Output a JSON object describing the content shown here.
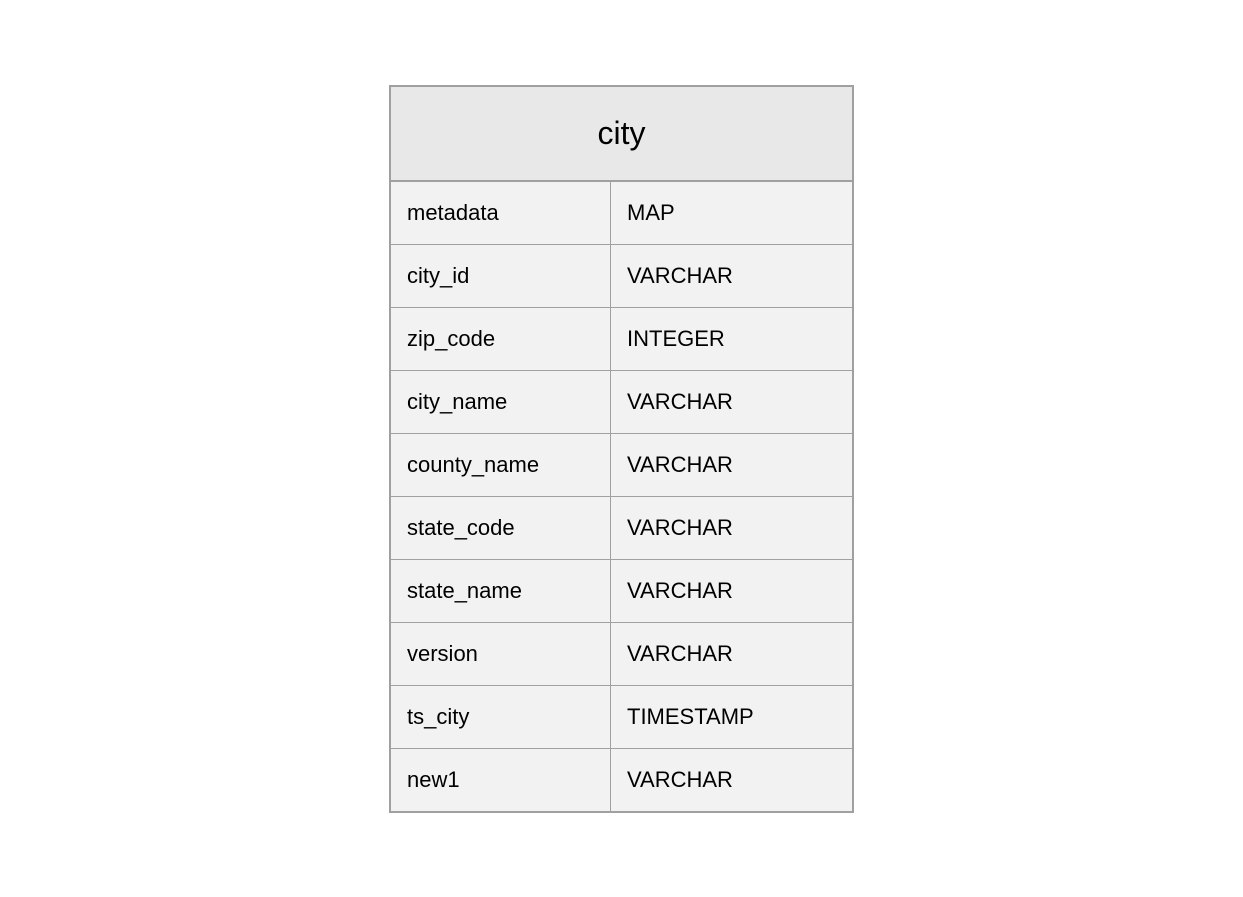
{
  "table": {
    "title": "city",
    "rows": [
      {
        "name": "metadata",
        "type": "MAP"
      },
      {
        "name": "city_id",
        "type": "VARCHAR"
      },
      {
        "name": "zip_code",
        "type": "INTEGER"
      },
      {
        "name": "city_name",
        "type": "VARCHAR"
      },
      {
        "name": "county_name",
        "type": "VARCHAR"
      },
      {
        "name": "state_code",
        "type": "VARCHAR"
      },
      {
        "name": "state_name",
        "type": "VARCHAR"
      },
      {
        "name": "version",
        "type": "VARCHAR"
      },
      {
        "name": "ts_city",
        "type": "TIMESTAMP"
      },
      {
        "name": "new1",
        "type": "VARCHAR"
      }
    ]
  }
}
